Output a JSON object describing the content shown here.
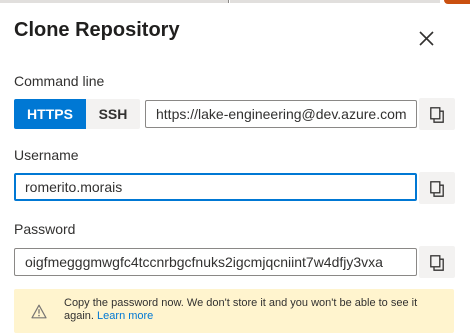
{
  "dialog": {
    "title": "Clone Repository"
  },
  "command_line": {
    "label": "Command line",
    "protocols": [
      "HTTPS",
      "SSH"
    ],
    "selected": "HTTPS",
    "url": "https://lake-engineering@dev.azure.com"
  },
  "username": {
    "label": "Username",
    "value": "romerito.morais"
  },
  "password": {
    "label": "Password",
    "value": "oigfmegggmwgfc4tccnrbgcfnuks2igcmjqcniint7w4dfjy3vxa"
  },
  "warning": {
    "message": "Copy the password now. We don't store it and you won't be able to see it again.",
    "link": "Learn more"
  },
  "icons": {
    "close": "close-icon",
    "copy": "copy-icon",
    "warning": "warning-icon"
  },
  "colors": {
    "accent": "#0078d4",
    "warning_bg": "#fff4ce",
    "warning_icon": "#797673"
  }
}
